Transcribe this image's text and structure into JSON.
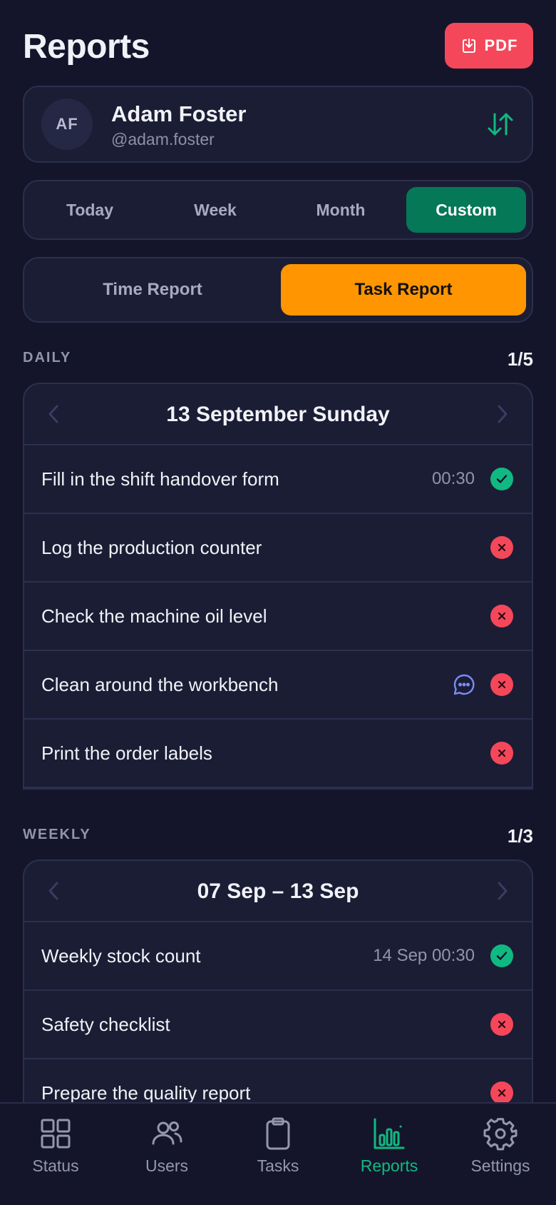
{
  "header": {
    "title": "Reports",
    "pdf_label": "PDF"
  },
  "profile": {
    "initials": "AF",
    "name": "Adam Foster",
    "handle": "@adam.foster"
  },
  "period_tabs": [
    {
      "label": "Today",
      "active": false
    },
    {
      "label": "Week",
      "active": false
    },
    {
      "label": "Month",
      "active": false
    },
    {
      "label": "Custom",
      "active": true
    }
  ],
  "report_tabs": [
    {
      "label": "Time Report",
      "active": false
    },
    {
      "label": "Task Report",
      "active": true
    }
  ],
  "daily": {
    "label": "DAILY",
    "count": "1/5",
    "date": "13 September Sunday",
    "tasks": [
      {
        "title": "Fill in the shift handover form",
        "time": "00:30",
        "status": "done"
      },
      {
        "title": "Log the production counter",
        "time": "",
        "status": "missed"
      },
      {
        "title": "Check the machine oil level",
        "time": "",
        "status": "missed"
      },
      {
        "title": "Clean around the workbench",
        "time": "",
        "status": "missed",
        "comment": true
      },
      {
        "title": "Print the order labels",
        "time": "",
        "status": "missed"
      }
    ]
  },
  "weekly": {
    "label": "WEEKLY",
    "count": "1/3",
    "date": "07 Sep – 13 Sep",
    "tasks": [
      {
        "title": "Weekly stock count",
        "time": "14 Sep 00:30",
        "status": "done"
      },
      {
        "title": "Safety checklist",
        "time": "",
        "status": "missed"
      },
      {
        "title": "Prepare the quality report",
        "time": "",
        "status": "missed"
      }
    ]
  },
  "tabbar": [
    {
      "label": "Status",
      "icon": "grid-icon",
      "active": false
    },
    {
      "label": "Users",
      "icon": "users-icon",
      "active": false
    },
    {
      "label": "Tasks",
      "icon": "clipboard-icon",
      "active": false
    },
    {
      "label": "Reports",
      "icon": "bar-chart-icon",
      "active": true
    },
    {
      "label": "Settings",
      "icon": "gear-icon",
      "active": false
    }
  ],
  "colors": {
    "background": "#14152a",
    "card": "#1b1d35",
    "accent_green": "#10b981",
    "custom_tab": "#047857",
    "task_report_tab": "#ff9500",
    "pdf_button": "#f5475a",
    "fail": "#f5475a"
  }
}
